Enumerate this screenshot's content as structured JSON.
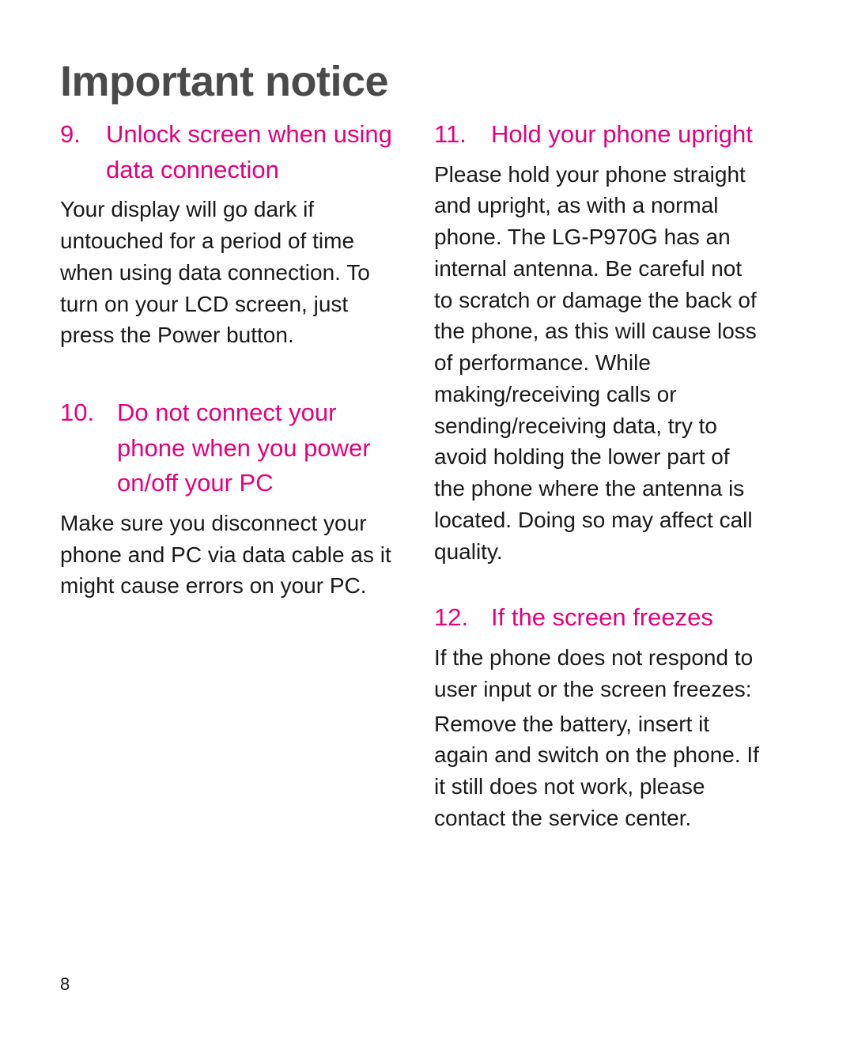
{
  "document": {
    "title": "Important notice",
    "page_number": "8"
  },
  "left_column": {
    "sections": [
      {
        "number": "9.",
        "title": "Unlock screen when using data connection",
        "paragraphs": [
          "Your display will go dark if untouched for a period of time when using data connection. To turn on your LCD screen, just press the Power button."
        ]
      },
      {
        "number": "10.",
        "title": "Do not connect your phone when you power on/off your PC",
        "paragraphs": [
          "Make sure you disconnect your phone and PC via data cable as it might cause errors on your PC."
        ]
      }
    ]
  },
  "right_column": {
    "sections": [
      {
        "number": "11.",
        "title": "Hold your phone upright",
        "paragraphs": [
          "Please hold your phone straight and upright, as with a normal phone. The LG-P970G has an internal antenna. Be careful not to scratch or damage the back of the phone, as this will cause loss of performance. While making/receiving calls or sending/receiving data, try to avoid holding the lower part of the phone where the antenna is located. Doing so may affect call quality."
        ]
      },
      {
        "number": "12.",
        "title": "If the screen freezes",
        "paragraphs": [
          "If the phone does not respond to user input or the screen freezes:",
          "Remove the battery, insert it again and switch on the phone. If it still does not work, please contact the service center."
        ]
      }
    ]
  }
}
